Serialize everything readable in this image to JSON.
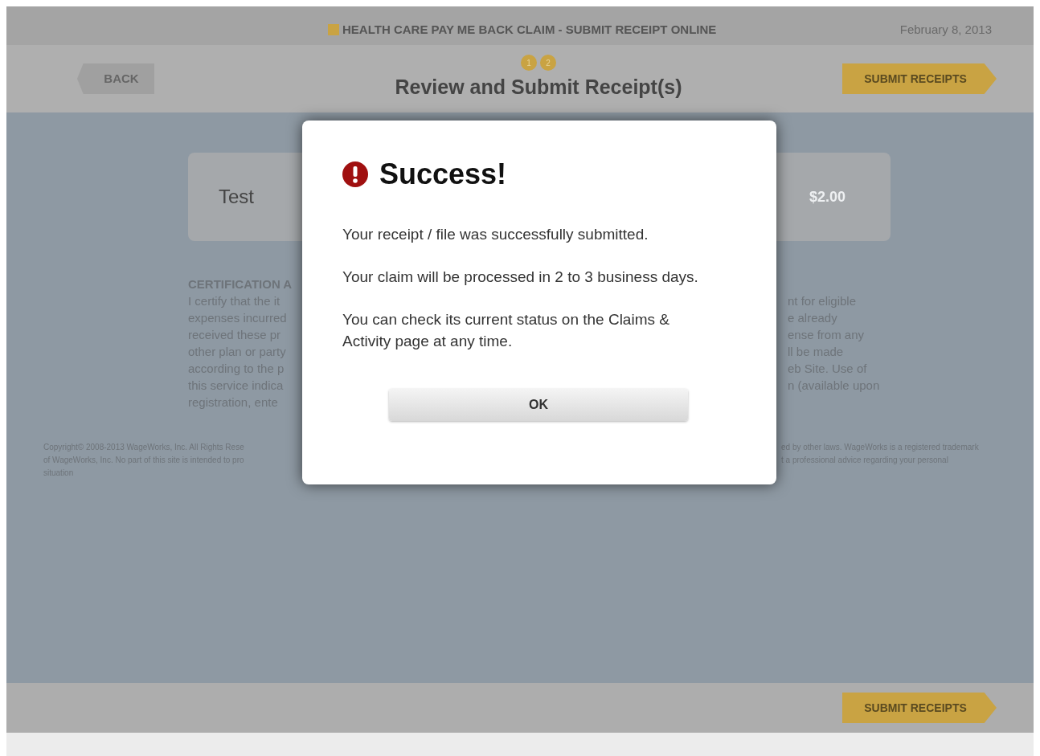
{
  "header": {
    "title": "HEALTH CARE PAY ME BACK CLAIM - SUBMIT RECEIPT ONLINE",
    "date": "February 8, 2013"
  },
  "toolbar": {
    "back": "BACK",
    "steps": [
      "1",
      "2"
    ],
    "title": "Review and Submit Receipt(s)",
    "submit": "SUBMIT RECEIPTS"
  },
  "receipt": {
    "name": "Test",
    "amount": "$2.00"
  },
  "certification": {
    "left_lines": [
      "CERTIFICATION A",
      "I certify that the it",
      "expenses incurred",
      "received these pr",
      "other plan or party",
      "according to the p",
      "this service indica",
      "registration, ente"
    ],
    "right_lines": [
      "nt for eligible",
      "e already",
      "ense from any",
      "ll be made",
      "eb Site. Use of",
      "n (available upon"
    ]
  },
  "copyright": {
    "left_lines": [
      "Copyright© 2008-2013 WageWorks, Inc. All Rights Rese",
      "of WageWorks, Inc. No part of this site is intended to pro",
      "situation"
    ],
    "right_lines": [
      "ed by other laws. WageWorks is a registered trademark",
      "t a professional advice regarding your personal"
    ]
  },
  "footer": {
    "submit": "SUBMIT RECEIPTS"
  },
  "dialog": {
    "title": "Success!",
    "paragraphs": [
      "Your receipt / file was successfully submitted.",
      "Your claim will be processed in 2 to 3 business days.",
      "You can check its current status on the Claims & Activity page at any time."
    ],
    "button": "OK"
  }
}
